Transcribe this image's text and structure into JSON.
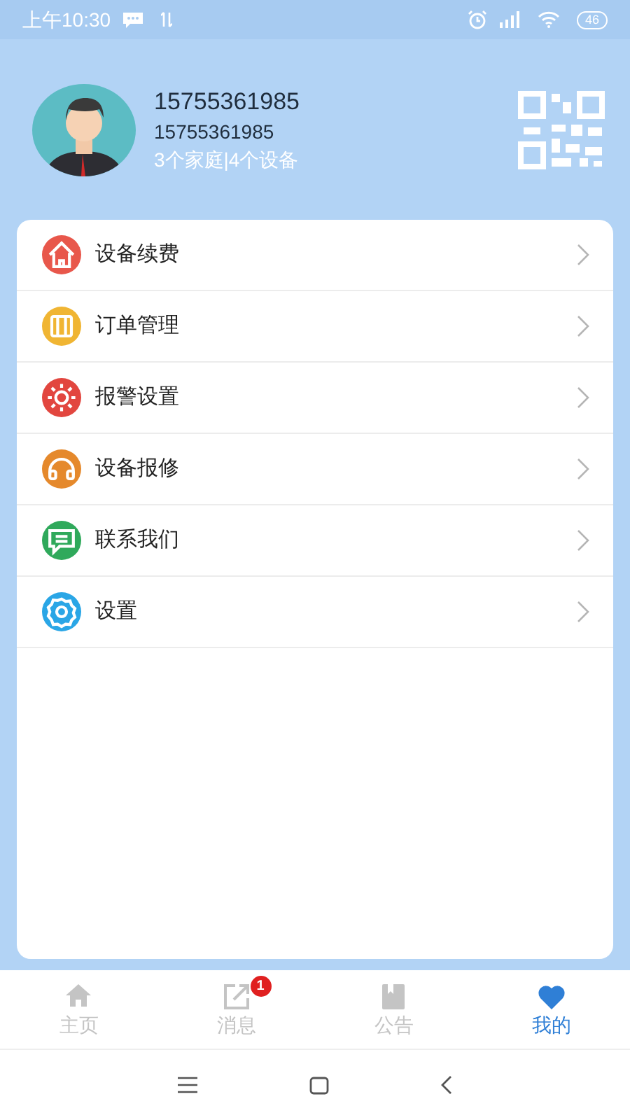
{
  "status_bar": {
    "time": "上午10:30",
    "battery": "46"
  },
  "profile": {
    "name": "15755361985",
    "phone": "15755361985",
    "summary": "3个家庭|4个设备"
  },
  "menu": [
    {
      "label": "设备续费",
      "kind": "home",
      "color": "#e8574b"
    },
    {
      "label": "订单管理",
      "kind": "film",
      "color": "#f0b533"
    },
    {
      "label": "报警设置",
      "kind": "sun",
      "color": "#e2463f"
    },
    {
      "label": "设备报修",
      "kind": "headset",
      "color": "#e5892c"
    },
    {
      "label": "联系我们",
      "kind": "chat",
      "color": "#2fa95b"
    },
    {
      "label": "设置",
      "kind": "gear",
      "color": "#2aa6e6"
    }
  ],
  "tabs": [
    {
      "label": "主页",
      "kind": "home",
      "selected": false
    },
    {
      "label": "消息",
      "kind": "edit",
      "selected": false,
      "badge": "1"
    },
    {
      "label": "公告",
      "kind": "book",
      "selected": false
    },
    {
      "label": "我的",
      "kind": "heart",
      "selected": true
    }
  ]
}
